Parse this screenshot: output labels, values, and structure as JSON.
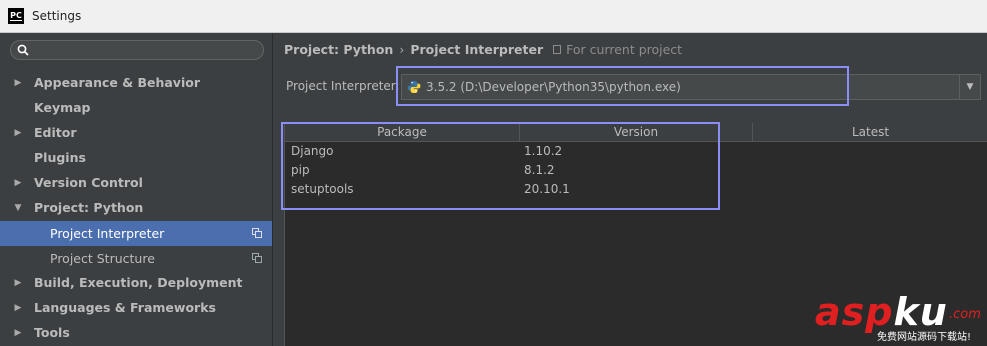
{
  "window": {
    "title": "Settings",
    "app_icon": "PC"
  },
  "search": {
    "placeholder": ""
  },
  "sidebar": {
    "items": [
      {
        "label": "Appearance & Behavior",
        "expandable": true,
        "expanded": false
      },
      {
        "label": "Keymap",
        "expandable": false
      },
      {
        "label": "Editor",
        "expandable": true,
        "expanded": false
      },
      {
        "label": "Plugins",
        "expandable": false
      },
      {
        "label": "Version Control",
        "expandable": true,
        "expanded": false
      },
      {
        "label": "Project: Python",
        "expandable": true,
        "expanded": true,
        "children": [
          {
            "label": "Project Interpreter",
            "selected": true
          },
          {
            "label": "Project Structure",
            "selected": false
          }
        ]
      },
      {
        "label": "Build, Execution, Deployment",
        "expandable": true,
        "expanded": false
      },
      {
        "label": "Languages & Frameworks",
        "expandable": true,
        "expanded": false
      },
      {
        "label": "Tools",
        "expandable": true,
        "expanded": false
      }
    ]
  },
  "breadcrumb": {
    "parent": "Project: Python",
    "separator": "›",
    "current": "Project Interpreter",
    "scope_note": "For current project"
  },
  "interpreter": {
    "label": "Project Interpreter:",
    "value": "3.5.2 (D:\\Developer\\Python35\\python.exe)"
  },
  "packages_table": {
    "columns": [
      "Package",
      "Version",
      "Latest"
    ],
    "rows": [
      {
        "package": "Django",
        "version": "1.10.2",
        "latest": ""
      },
      {
        "package": "pip",
        "version": "8.1.2",
        "latest": ""
      },
      {
        "package": "setuptools",
        "version": "20.10.1",
        "latest": ""
      }
    ]
  },
  "watermark": {
    "brand_a": "asp",
    "brand_b": "ku",
    "suffix": ".com",
    "tagline": "免费网站源码下载站!"
  },
  "colors": {
    "background": "#3c3f41",
    "table_background": "#2b2b2b",
    "selection": "#4b6eaf",
    "highlight_box": "#8a8ef5",
    "watermark_red": "#e02020"
  }
}
